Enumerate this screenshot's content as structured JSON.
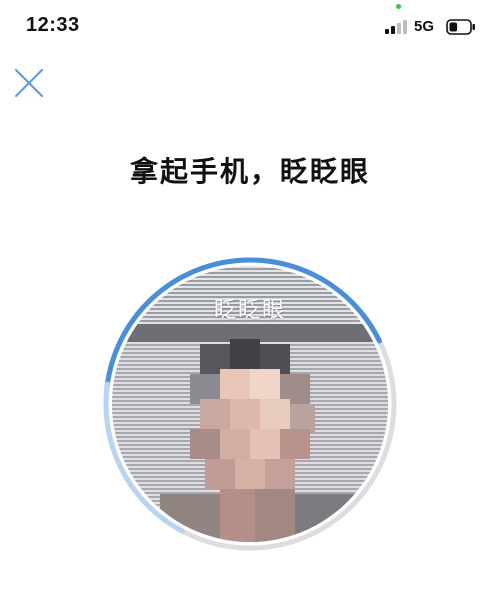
{
  "status_bar": {
    "time": "12:33",
    "network": "5G",
    "signal_icon": "signal-bars-icon",
    "battery_icon": "battery-icon",
    "battery_level": 0.4
  },
  "nav": {
    "close_icon": "close-icon"
  },
  "instruction": {
    "title": "拿起手机，眨眨眼",
    "prompt": "眨眨眼"
  },
  "colors": {
    "accent": "#4a8ed8",
    "accent_light": "#b9d4f0",
    "ring_track": "#dddddd",
    "close_icon": "#5b9be0"
  },
  "progress": {
    "fraction": 0.6
  }
}
